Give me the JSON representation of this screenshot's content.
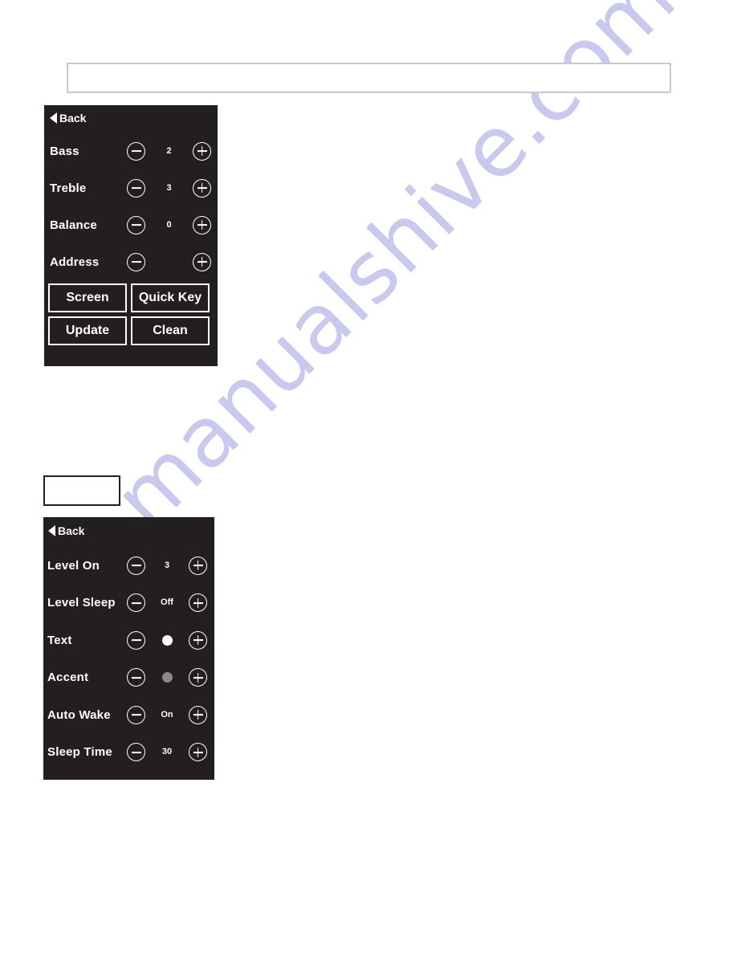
{
  "page": {
    "background_color": "#ffffff",
    "panel_background_color": "#231f20",
    "panel_foreground_color": "#ffffff"
  },
  "watermark": {
    "text": "manualshive.com",
    "color": "#c9c9ef"
  },
  "top_text_box": {
    "value": "",
    "placeholder": "",
    "border_color": "#c8c8c8"
  },
  "mid_text_box": {
    "value": "",
    "placeholder": "",
    "border_color": "#231f20"
  },
  "audio_panel": {
    "back": {
      "label": "Back",
      "icon": "back-triangle-icon"
    },
    "rows": [
      {
        "label": "Bass",
        "value": "2",
        "type": "number",
        "minus_icon": "minus-circle-icon",
        "plus_icon": "plus-circle-icon"
      },
      {
        "label": "Treble",
        "value": "3",
        "type": "number",
        "minus_icon": "minus-circle-icon",
        "plus_icon": "plus-circle-icon"
      },
      {
        "label": "Balance",
        "value": "0",
        "type": "number",
        "minus_icon": "minus-circle-icon",
        "plus_icon": "plus-circle-icon"
      },
      {
        "label": "Address",
        "value": "",
        "type": "empty",
        "minus_icon": "minus-circle-icon",
        "plus_icon": "plus-circle-icon"
      }
    ],
    "buttons": [
      {
        "label": "Screen"
      },
      {
        "label": "Quick Key"
      },
      {
        "label": "Update"
      },
      {
        "label": "Clean"
      }
    ]
  },
  "display_panel": {
    "back": {
      "label": "Back",
      "icon": "back-triangle-icon"
    },
    "rows": [
      {
        "label": "Level On",
        "value": "3",
        "type": "number",
        "minus_icon": "minus-circle-icon",
        "plus_icon": "plus-circle-icon"
      },
      {
        "label": "Level Sleep",
        "value": "Off",
        "type": "text",
        "minus_icon": "minus-circle-icon",
        "plus_icon": "plus-circle-icon"
      },
      {
        "label": "Text",
        "value": "",
        "type": "swatch",
        "swatch_color": "#ffffff",
        "minus_icon": "minus-circle-icon",
        "plus_icon": "plus-circle-icon"
      },
      {
        "label": "Accent",
        "value": "",
        "type": "swatch",
        "swatch_color": "#8a8a8a",
        "minus_icon": "minus-circle-icon",
        "plus_icon": "plus-circle-icon"
      },
      {
        "label": "Auto Wake",
        "value": "On",
        "type": "text",
        "minus_icon": "minus-circle-icon",
        "plus_icon": "plus-circle-icon"
      },
      {
        "label": "Sleep Time",
        "value": "30",
        "type": "number",
        "minus_icon": "minus-circle-icon",
        "plus_icon": "plus-circle-icon"
      }
    ]
  }
}
